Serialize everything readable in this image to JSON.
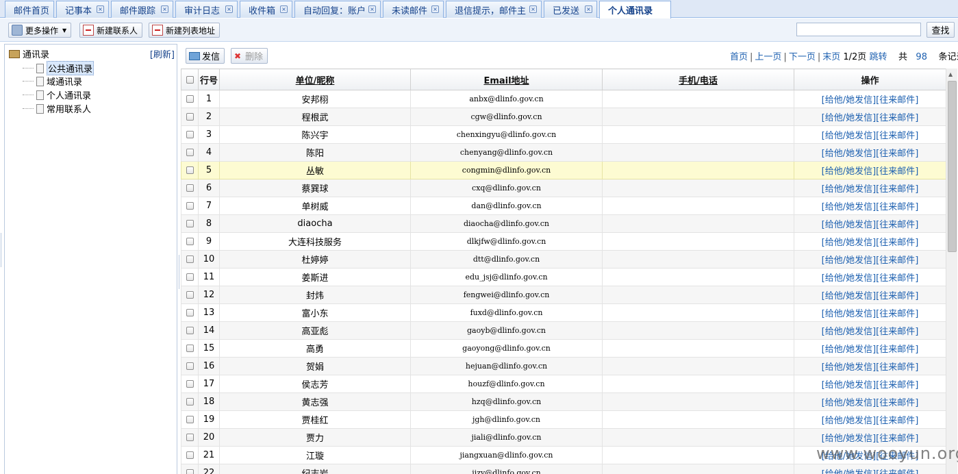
{
  "tabs": [
    {
      "label": "邮件首页",
      "closable": false,
      "active": false
    },
    {
      "label": "记事本",
      "closable": true,
      "active": false
    },
    {
      "label": "邮件跟踪",
      "closable": true,
      "active": false
    },
    {
      "label": "审计日志",
      "closable": true,
      "active": false
    },
    {
      "label": "收件箱",
      "closable": true,
      "active": false
    },
    {
      "label": "自动回复：账户",
      "closable": true,
      "active": false
    },
    {
      "label": "未读邮件",
      "closable": true,
      "active": false
    },
    {
      "label": "退信提示，邮件主",
      "closable": true,
      "active": false
    },
    {
      "label": "已发送",
      "closable": true,
      "active": false
    },
    {
      "label": "个人通讯录",
      "closable": false,
      "active": true
    }
  ],
  "toolbar": {
    "more_label": "更多操作",
    "new_contact_label": "新建联系人",
    "new_list_label": "新建列表地址",
    "search_placeholder": "",
    "search_button": "查找"
  },
  "tree": {
    "root": "通讯录",
    "refresh": "[刷新]",
    "items": [
      "公共通讯录",
      "域通讯录",
      "个人通讯录",
      "常用联系人"
    ]
  },
  "actions": {
    "send": "发信",
    "delete": "删除"
  },
  "pager": {
    "first": "首页",
    "prev": "上一页",
    "next": "下一页",
    "last": "末页",
    "page_info": "1/2页",
    "jump": "跳转",
    "total_prefix": "共",
    "total": "98",
    "total_suffix": "条记录"
  },
  "grid": {
    "headers": [
      "行号",
      "单位/昵称",
      "Email地址",
      "手机/电话",
      "操作"
    ],
    "ops_label": "[给他/她发信][往来邮件]",
    "rows": [
      {
        "no": "1",
        "name": "安邦栩",
        "email": "anbx@dlinfo.gov.cn",
        "phone": ""
      },
      {
        "no": "2",
        "name": "程根武",
        "email": "cgw@dlinfo.gov.cn",
        "phone": ""
      },
      {
        "no": "3",
        "name": "陈兴宇",
        "email": "chenxingyu@dlinfo.gov.cn",
        "phone": ""
      },
      {
        "no": "4",
        "name": "陈阳",
        "email": "chenyang@dlinfo.gov.cn",
        "phone": ""
      },
      {
        "no": "5",
        "name": "丛敏",
        "email": "congmin@dlinfo.gov.cn",
        "phone": ""
      },
      {
        "no": "6",
        "name": "蔡巽球",
        "email": "cxq@dlinfo.gov.cn",
        "phone": ""
      },
      {
        "no": "7",
        "name": "单树威",
        "email": "dan@dlinfo.gov.cn",
        "phone": ""
      },
      {
        "no": "8",
        "name": "diaocha",
        "email": "diaocha@dlinfo.gov.cn",
        "phone": ""
      },
      {
        "no": "9",
        "name": "大连科技服务",
        "email": "dlkjfw@dlinfo.gov.cn",
        "phone": ""
      },
      {
        "no": "10",
        "name": "杜婷婷",
        "email": "dtt@dlinfo.gov.cn",
        "phone": ""
      },
      {
        "no": "11",
        "name": "姜斯进",
        "email": "edu_jsj@dlinfo.gov.cn",
        "phone": ""
      },
      {
        "no": "12",
        "name": "封炜",
        "email": "fengwei@dlinfo.gov.cn",
        "phone": ""
      },
      {
        "no": "13",
        "name": "富小东",
        "email": "fuxd@dlinfo.gov.cn",
        "phone": ""
      },
      {
        "no": "14",
        "name": "高亚彪",
        "email": "gaoyb@dlinfo.gov.cn",
        "phone": ""
      },
      {
        "no": "15",
        "name": "高勇",
        "email": "gaoyong@dlinfo.gov.cn",
        "phone": ""
      },
      {
        "no": "16",
        "name": "贺娟",
        "email": "hejuan@dlinfo.gov.cn",
        "phone": ""
      },
      {
        "no": "17",
        "name": "侯志芳",
        "email": "houzf@dlinfo.gov.cn",
        "phone": ""
      },
      {
        "no": "18",
        "name": "黄志强",
        "email": "hzq@dlinfo.gov.cn",
        "phone": ""
      },
      {
        "no": "19",
        "name": "贾桂红",
        "email": "jgh@dlinfo.gov.cn",
        "phone": ""
      },
      {
        "no": "20",
        "name": "贾力",
        "email": "jiali@dlinfo.gov.cn",
        "phone": ""
      },
      {
        "no": "21",
        "name": "江璇",
        "email": "jiangxuan@dlinfo.gov.cn",
        "phone": ""
      },
      {
        "no": "22",
        "name": "纪志岩",
        "email": "jizy@dlinfo.gov.cn",
        "phone": ""
      }
    ],
    "highlighted_row": 5
  },
  "colors": {
    "tab_text": "#15428b",
    "link": "#1d60b0",
    "highlight_row": "#fdfbd2"
  },
  "watermark": "www.wooyun.org"
}
